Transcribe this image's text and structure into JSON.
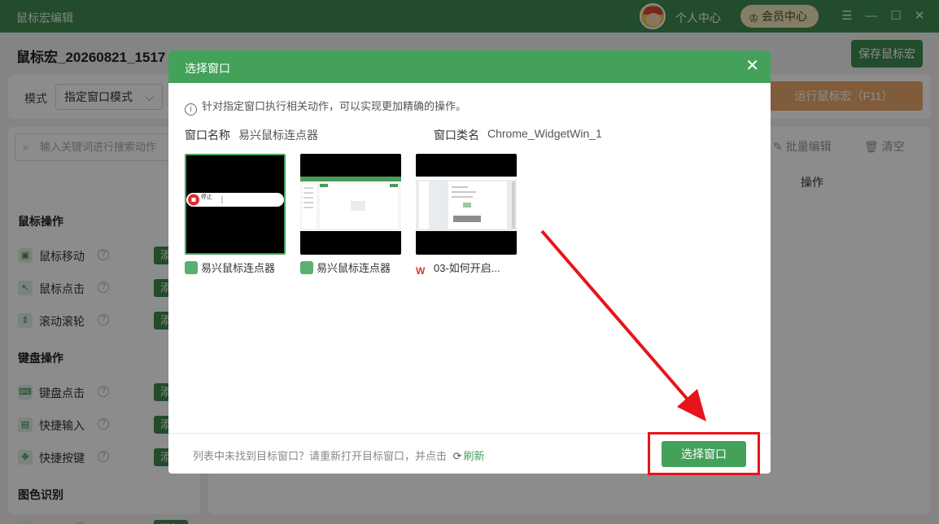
{
  "window": {
    "title": "鼠标宏编辑",
    "user_center": "个人中心",
    "vip": "会员中心",
    "controls": [
      "menu-icon",
      "minimize-icon",
      "maximize-icon",
      "close-icon"
    ]
  },
  "editor": {
    "macro_name": "鼠标宏_20260821_1517",
    "save_label": "保存鼠标宏",
    "mode_label": "模式",
    "mode_value": "指定窗口模式",
    "run_label": "运行鼠标宏（F11）",
    "search_placeholder": "输入关键词进行搜索动作",
    "categories": [
      {
        "title": "鼠标操作",
        "items": [
          {
            "label": "鼠标移动",
            "icon": "mouse-icon"
          },
          {
            "label": "鼠标点击",
            "icon": "cursor-click-icon"
          },
          {
            "label": "滚动滚轮",
            "icon": "scroll-icon"
          }
        ]
      },
      {
        "title": "键盘操作",
        "items": [
          {
            "label": "键盘点击",
            "icon": "keyboard-icon"
          },
          {
            "label": "快捷输入",
            "icon": "keyboard-input-icon"
          },
          {
            "label": "快捷按键",
            "icon": "gamepad-icon"
          }
        ]
      },
      {
        "title": "图色识别",
        "items": [
          {
            "label": "找图",
            "icon": "image-icon"
          }
        ]
      }
    ],
    "add_label": "添加",
    "batch_edit": "批量编辑",
    "clear": "清空",
    "op_column": "操作"
  },
  "modal": {
    "title": "选择窗口",
    "info": "针对指定窗口执行相关动作，可以实现更加精确的操作。",
    "name_label": "窗口名称",
    "name_value": "易兴鼠标连点器",
    "class_label": "窗口类名",
    "class_value": "Chrome_WidgetWin_1",
    "windows": [
      {
        "caption": "易兴鼠标连点器",
        "selected": true,
        "icon": "yixing-app-icon",
        "pill_text": "停止"
      },
      {
        "caption": "易兴鼠标连点器",
        "selected": false,
        "icon": "yixing-app-icon"
      },
      {
        "caption": "03-如何开启...",
        "selected": false,
        "icon": "wps-icon"
      }
    ],
    "footer_hint": "列表中未找到目标窗口？请重新打开目标窗口，并点击",
    "refresh": "刷新",
    "confirm": "选择窗口"
  },
  "colors": {
    "brand_green": "#44a15a",
    "annotation_red": "#e8141b",
    "run_orange": "#e9a86a"
  }
}
